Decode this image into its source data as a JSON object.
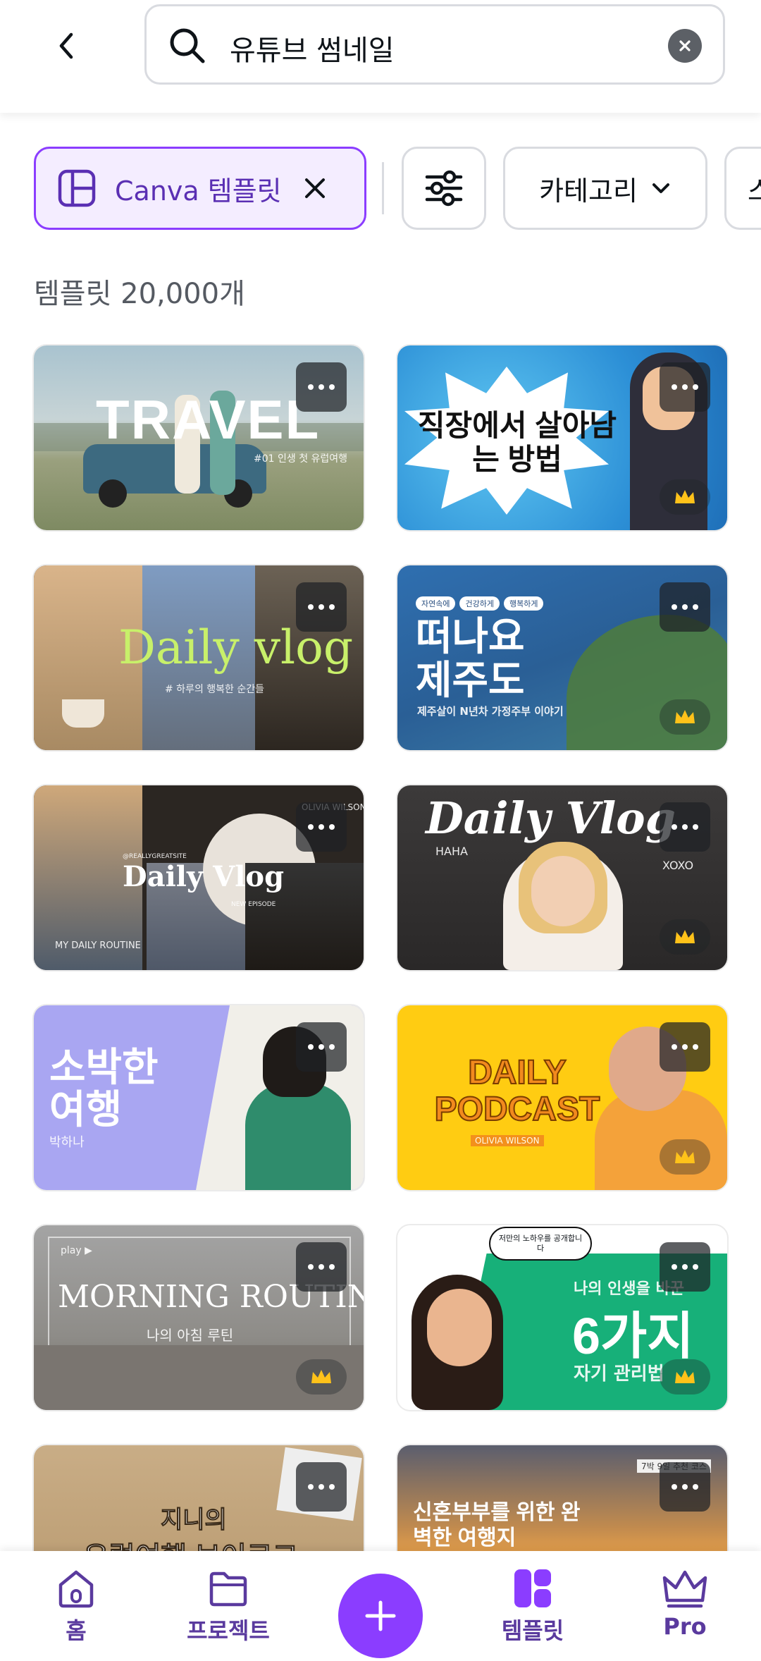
{
  "search": {
    "query": "유튜브 썸네일"
  },
  "filters": {
    "canva_chip": "Canva 템플릿",
    "category_chip": "카테고리",
    "partial_chip": "스"
  },
  "results": {
    "count_text": "템플릿 20,000개"
  },
  "templates": [
    {
      "title": "TRAVEL",
      "subtitle": "#01 인생 첫 유럽여행",
      "pro": false
    },
    {
      "title": "직장에서 살아남는 방법",
      "pro": true
    },
    {
      "title": "Daily vlog",
      "subtitle": "# 하루의 행복한 순간들",
      "pro": false
    },
    {
      "title": "떠나요 제주도",
      "subtitle": "제주살이 N년차 가정주부 이야기",
      "tags": [
        "자연속에",
        "건강하게",
        "행복하게"
      ],
      "pro": true
    },
    {
      "title": "Daily Vlog",
      "subtitle": "MY DAILY ROUTINE",
      "extra": [
        "OLIVIA WILSON",
        "@REALLYGREATSITE",
        "NEW EPISODE"
      ],
      "pro": false
    },
    {
      "title": "Daily Vlog",
      "extra": [
        "HAHA",
        "XOXO"
      ],
      "pro": true
    },
    {
      "title": "소박한 여행",
      "subtitle": "박하나",
      "pro": false
    },
    {
      "title": "DAILY PODCAST",
      "subtitle": "OLIVIA WILSON",
      "pro": true
    },
    {
      "title": "MORNING ROUTINE",
      "subtitle": "나의 아침 루틴",
      "extra": [
        "play ▶"
      ],
      "pro": true
    },
    {
      "title": "6가지",
      "subtitle": "나의 인생을 바꾼",
      "extra": [
        "자기 관리법",
        "저만의 노하우를 공개합니다"
      ],
      "pro": true
    },
    {
      "title": "지니의",
      "subtitle": "유럽여행 브이로그",
      "pro": false
    },
    {
      "title": "신혼부부를 위한 완벽한 여행지",
      "extra": [
        "7박 9일 추천 코스"
      ],
      "pro": false
    }
  ],
  "nav": {
    "home": "홈",
    "projects": "프로젝트",
    "templates": "템플릿",
    "pro": "Pro"
  },
  "colors": {
    "accent": "#8b3dff",
    "nav_text": "#5a3a9e",
    "chip_selected_bg": "#f4edff"
  }
}
